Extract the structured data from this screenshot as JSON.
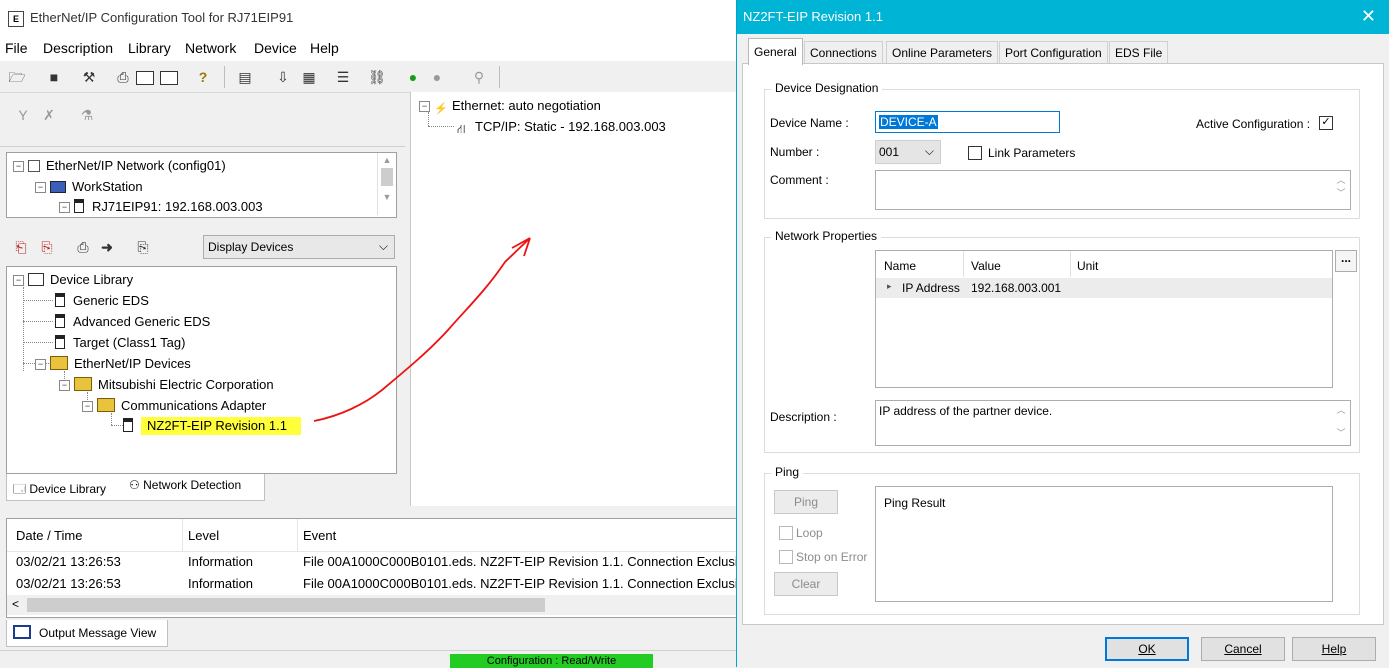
{
  "main": {
    "title": "EtherNet/IP Configuration Tool for RJ71EIP91",
    "app_icon": "EtherNet/IP tool icon",
    "menu": [
      "File",
      "Description",
      "Library",
      "Network",
      "Device",
      "Help"
    ],
    "network_tree": {
      "root": "EtherNet/IP Network (config01)",
      "workstation": "WorkStation",
      "module": "RJ71EIP91: 192.168.003.003"
    },
    "display_select": "Display Devices",
    "library_tree": {
      "root": "Device Library",
      "items": [
        "Generic EDS",
        "Advanced Generic EDS",
        "Target (Class1 Tag)",
        "EtherNet/IP Devices"
      ],
      "vendor": "Mitsubishi Electric Corporation",
      "category": "Communications Adapter",
      "device": "NZ2FT-EIP Revision 1.1"
    },
    "bottom_tabs": [
      "Device Library",
      "Network Detection"
    ],
    "center_tree": {
      "ethernet": "Ethernet: auto negotiation",
      "tcpip": "TCP/IP: Static - 192.168.003.003"
    },
    "log": {
      "headers": [
        "Date / Time",
        "Level",
        "Event"
      ],
      "rows": [
        [
          "03/02/21 13:26:53",
          "Information",
          "File 00A1000C000B0101.eds. NZ2FT-EIP Revision 1.1. Connection Exclusi"
        ],
        [
          "03/02/21 13:26:53",
          "Information",
          "File 00A1000C000B0101.eds. NZ2FT-EIP Revision 1.1. Connection Exclusi"
        ]
      ],
      "scroll_left": "<"
    },
    "output_tab": "Output Message View",
    "status": "Configuration : Read/Write",
    "highlight_color": "#ffff3c",
    "status_color": "#22cc22"
  },
  "dialog": {
    "title": "NZ2FT-EIP Revision 1.1",
    "close": "✕",
    "tabs": [
      "General",
      "Connections",
      "Online Parameters",
      "Port Configuration",
      "EDS File"
    ],
    "device_designation": {
      "legend": "Device Designation",
      "name_label": "Device Name :",
      "name_value": "DEVICE-A",
      "active_label": "Active Configuration :",
      "active_checked": true,
      "number_label": "Number :",
      "number_value": "001",
      "link_label": "Link Parameters",
      "comment_label": "Comment :"
    },
    "network_properties": {
      "legend": "Network Properties",
      "headers": [
        "Name",
        "Value",
        "Unit"
      ],
      "row_name": "IP Address",
      "row_value": "192.168.003.001",
      "more_button": "...",
      "description_label": "Description :",
      "description_value": "IP address of the partner device."
    },
    "ping": {
      "legend": "Ping",
      "ping_button": "Ping",
      "loop_label": "Loop",
      "stop_label": "Stop on Error",
      "clear_button": "Clear",
      "result_label": "Ping Result"
    },
    "buttons": {
      "ok": "OK",
      "cancel": "Cancel",
      "help": "Help"
    }
  }
}
